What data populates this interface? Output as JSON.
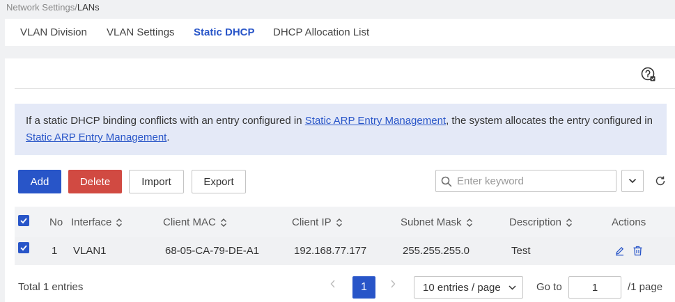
{
  "breadcrumb": {
    "parent": "Network Settings",
    "separator": "/",
    "current": "LANs"
  },
  "tabs": [
    {
      "label": "VLAN Division",
      "active": false
    },
    {
      "label": "VLAN Settings",
      "active": false
    },
    {
      "label": "Static DHCP",
      "active": true
    },
    {
      "label": "DHCP Allocation List",
      "active": false
    }
  ],
  "notice": {
    "text1": "If a static DHCP binding conflicts with an entry configured in ",
    "link1": "Static ARP Entry Management",
    "text2": ", the system allocates the entry configured in ",
    "link2": "Static ARP Entry Management",
    "text3": "."
  },
  "toolbar": {
    "add": "Add",
    "delete": "Delete",
    "import": "Import",
    "export": "Export"
  },
  "search": {
    "placeholder": "Enter keyword",
    "value": ""
  },
  "table": {
    "columns": {
      "no": "No",
      "interface": "Interface",
      "client_mac": "Client MAC",
      "client_ip": "Client IP",
      "subnet_mask": "Subnet Mask",
      "description": "Description",
      "actions": "Actions"
    },
    "rows": [
      {
        "no": "1",
        "interface": "VLAN1",
        "client_mac": "68-05-CA-79-DE-A1",
        "client_ip": "192.168.77.177",
        "subnet_mask": "255.255.255.0",
        "description": "Test",
        "selected": true
      }
    ]
  },
  "pagination": {
    "total": "Total 1 entries",
    "current_page": "1",
    "page_size": "10 entries / page",
    "goto_label": "Go to",
    "goto_value": "1",
    "pages_label": "/1 page"
  },
  "icons": [
    "help-icon",
    "search-icon",
    "chevron-down-icon",
    "refresh-icon",
    "sort-icon",
    "checkbox-checked-icon",
    "edit-icon",
    "delete-icon",
    "chevron-left-icon",
    "chevron-right-icon"
  ],
  "colors": {
    "primary": "#2855c8",
    "danger": "#d14a42",
    "notice_bg": "#e4e9f7"
  }
}
